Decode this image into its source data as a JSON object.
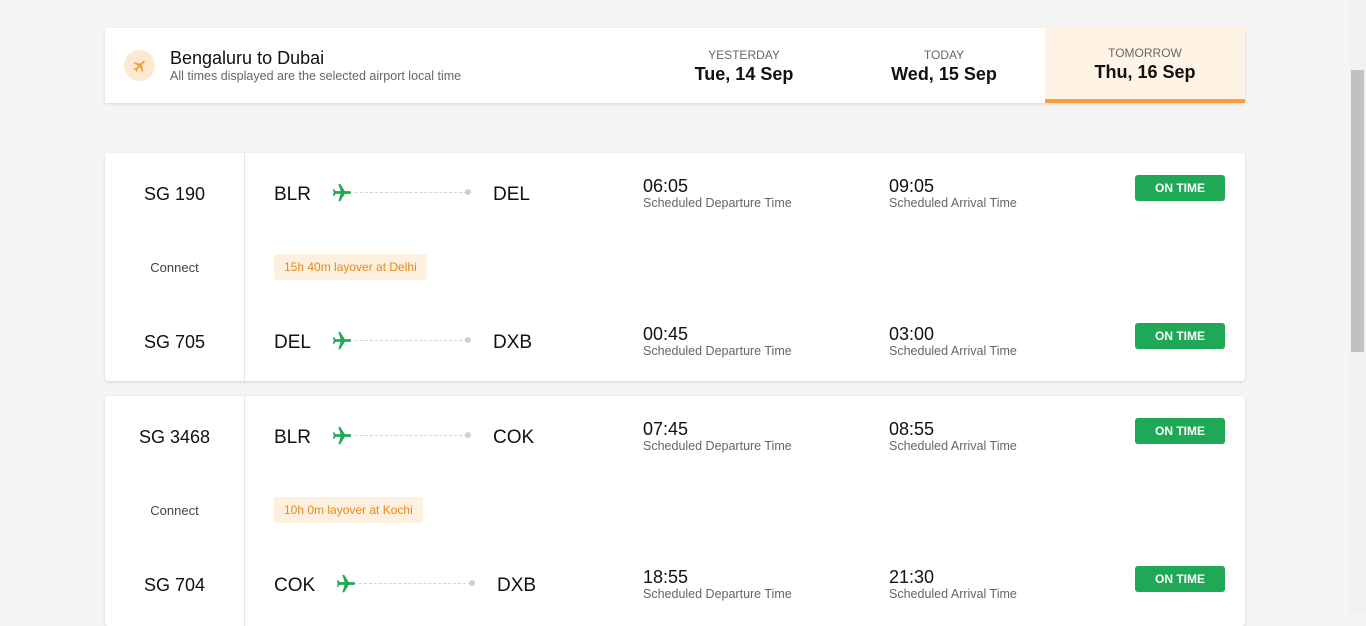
{
  "header": {
    "title": "Bengaluru to Dubai",
    "subtitle": "All times displayed are the selected airport local time",
    "days": [
      {
        "label": "YESTERDAY",
        "date": "Tue, 14 Sep"
      },
      {
        "label": "TODAY",
        "date": "Wed, 15 Sep"
      },
      {
        "label": "TOMORROW",
        "date": "Thu, 16 Sep",
        "active": true
      }
    ]
  },
  "common": {
    "connect": "Connect",
    "dep_label": "Scheduled Departure Time",
    "arr_label": "Scheduled Arrival Time"
  },
  "itineraries": [
    {
      "leg1": {
        "flight": "SG 190",
        "from": "BLR",
        "to": "DEL",
        "dep": "06:05",
        "arr": "09:05",
        "status": "ON TIME"
      },
      "layover": "15h 40m layover at Delhi",
      "leg2": {
        "flight": "SG 705",
        "from": "DEL",
        "to": "DXB",
        "dep": "00:45",
        "arr": "03:00",
        "status": "ON TIME"
      }
    },
    {
      "leg1": {
        "flight": "SG 3468",
        "from": "BLR",
        "to": "COK",
        "dep": "07:45",
        "arr": "08:55",
        "status": "ON TIME"
      },
      "layover": "10h 0m layover at Kochi",
      "leg2": {
        "flight": "SG 704",
        "from": "COK",
        "to": "DXB",
        "dep": "18:55",
        "arr": "21:30",
        "status": "ON TIME"
      }
    }
  ],
  "colors": {
    "accent": "#f5a03a",
    "status_green": "#1fa855",
    "plane_green": "#1fa855"
  }
}
